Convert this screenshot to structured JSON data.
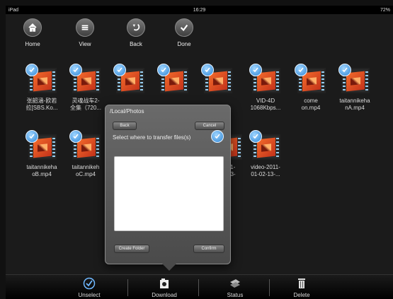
{
  "statusbar": {
    "device": "iPad",
    "time": "16:29",
    "battery": "72%"
  },
  "toolbar": [
    {
      "label": "Home",
      "icon": "home-icon"
    },
    {
      "label": "View",
      "icon": "list-icon"
    },
    {
      "label": "Back",
      "icon": "back-arrow-icon"
    },
    {
      "label": "Done",
      "icon": "checkmark-icon"
    }
  ],
  "files": [
    {
      "name": "张韶涵-欧若\n拉[SBS.Ko...",
      "selected": true
    },
    {
      "name": "灵魂战车2-\n全集（720...",
      "selected": true
    },
    {
      "name": "",
      "selected": true
    },
    {
      "name": "",
      "selected": true
    },
    {
      "name": "",
      "selected": true
    },
    {
      "name": "VID-4D\n1068Kbps...",
      "selected": true
    },
    {
      "name": "come\non.mp4",
      "selected": true
    },
    {
      "name": "taitannikeha\nnA.mp4",
      "selected": true
    },
    {
      "name": "taitannikeha\noB.mp4",
      "selected": true
    },
    {
      "name": "taitannikeh\noC.mp4",
      "selected": true
    },
    {
      "name": "-2011-\n02-13-",
      "selected": true
    },
    {
      "name": "video-2011-\n01-02-13-...",
      "selected": true
    }
  ],
  "popover": {
    "path": "/Local/Photos",
    "back_label": "Back",
    "cancel_label": "Cancel",
    "prompt": "Select where to transfer files(s)",
    "create_folder_label": "Create Folder",
    "confirm_label": "Confirm"
  },
  "bottombar": [
    {
      "label": "Unselect",
      "icon": "unselect-icon"
    },
    {
      "label": "Download",
      "icon": "download-icon"
    },
    {
      "label": "Status",
      "icon": "status-icon"
    },
    {
      "label": "Delete",
      "icon": "trash-icon"
    }
  ]
}
